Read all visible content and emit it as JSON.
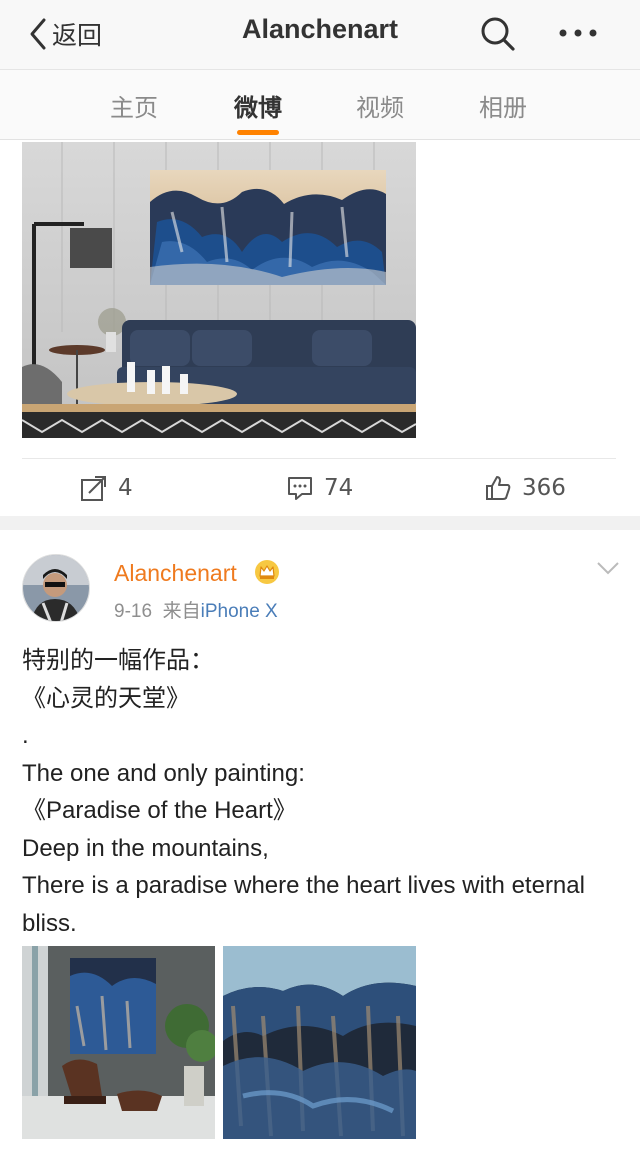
{
  "nav": {
    "back_label": "返回",
    "title": "Alanchenart"
  },
  "tabs": [
    {
      "label": "主页"
    },
    {
      "label": "微博"
    },
    {
      "label": "视频"
    },
    {
      "label": "相册"
    }
  ],
  "active_tab": "微博",
  "accent_color": "#ff8200",
  "post1": {
    "actions": {
      "repost_count": "4",
      "comment_count": "74",
      "like_count": "366"
    }
  },
  "post2": {
    "username": "Alanchenart",
    "date": "9-16",
    "from_label": "来自",
    "source": "iPhone X",
    "text_lines": [
      "特别的一幅作品：",
      "《心灵的天堂》",
      ".",
      "The one and only painting:",
      "《Paradise of the Heart》",
      "Deep in the mountains,",
      "There is a paradise where the heart lives with eternal bliss."
    ]
  }
}
